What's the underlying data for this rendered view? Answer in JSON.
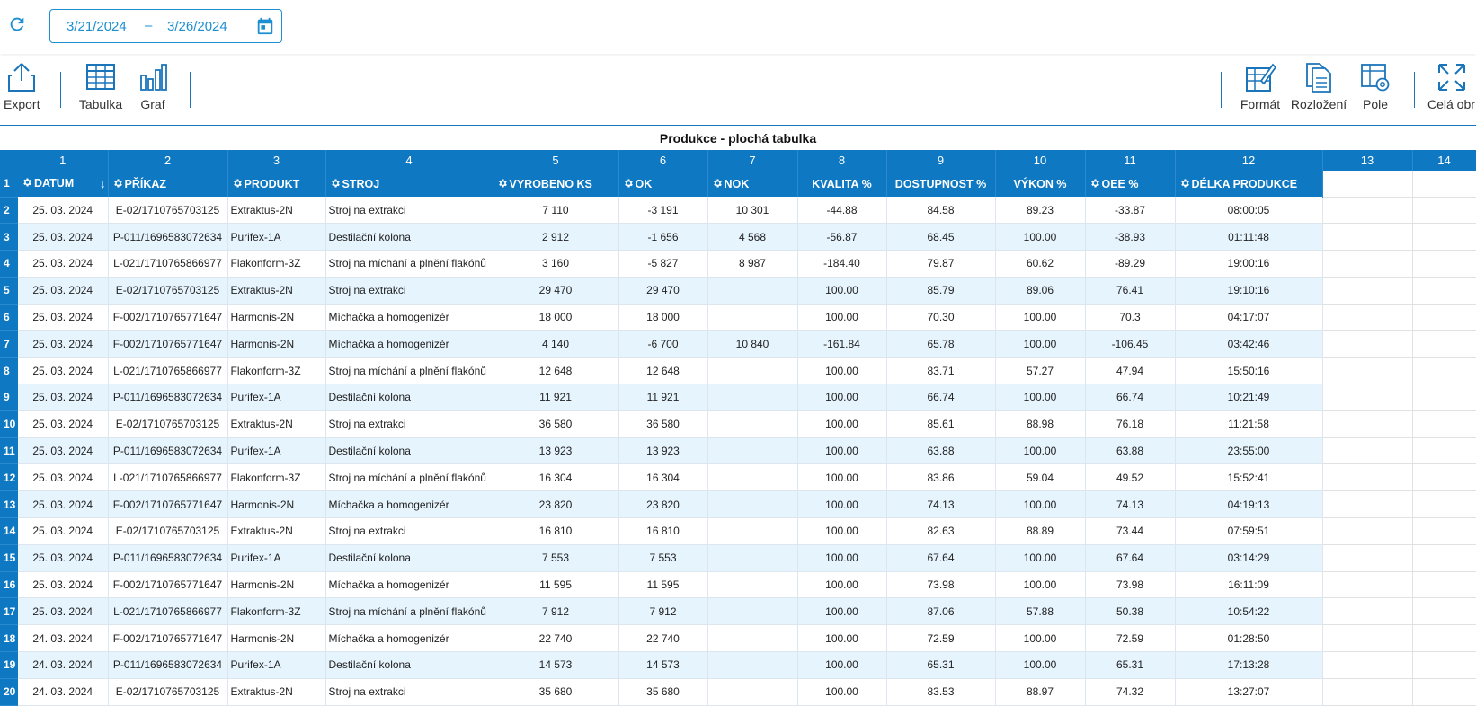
{
  "date_range": {
    "start": "3/21/2024",
    "separator": "–",
    "end": "3/26/2024"
  },
  "toolbar": {
    "export": "Export",
    "tabulka": "Tabulka",
    "graf": "Graf",
    "format": "Formát",
    "rozlozeni": "Rozložení",
    "pole": "Pole",
    "cela": "Celá obr"
  },
  "grid": {
    "title": "Produkce - plochá tabulka",
    "col_numbers": [
      "1",
      "2",
      "3",
      "4",
      "5",
      "6",
      "7",
      "8",
      "9",
      "10",
      "11",
      "12",
      "13",
      "14"
    ],
    "header_row_number": "1",
    "headers": [
      "DATUM",
      "PŘÍKAZ",
      "PRODUKT",
      "STROJ",
      "VYROBENO KS",
      "OK",
      "NOK",
      "KVALITA %",
      "DOSTUPNOST %",
      "VÝKON %",
      "OEE %",
      "DÉLKA PRODUKCE"
    ],
    "rows": [
      {
        "n": "2",
        "c": [
          "25. 03. 2024",
          "E-02/1710765703125",
          "Extraktus-2N",
          "Stroj na extrakci",
          "7 110",
          "-3 191",
          "10 301",
          "-44.88",
          "84.58",
          "89.23",
          "-33.87",
          "08:00:05"
        ]
      },
      {
        "n": "3",
        "c": [
          "25. 03. 2024",
          "P-011/1696583072634",
          "Purifex-1A",
          "Destilační kolona",
          "2 912",
          "-1 656",
          "4 568",
          "-56.87",
          "68.45",
          "100.00",
          "-38.93",
          "01:11:48"
        ]
      },
      {
        "n": "4",
        "c": [
          "25. 03. 2024",
          "L-021/1710765866977",
          "Flakonform-3Z",
          "Stroj na míchání a plnění flakónů",
          "3 160",
          "-5 827",
          "8 987",
          "-184.40",
          "79.87",
          "60.62",
          "-89.29",
          "19:00:16"
        ]
      },
      {
        "n": "5",
        "c": [
          "25. 03. 2024",
          "E-02/1710765703125",
          "Extraktus-2N",
          "Stroj na extrakci",
          "29 470",
          "29 470",
          "",
          "100.00",
          "85.79",
          "89.06",
          "76.41",
          "19:10:16"
        ]
      },
      {
        "n": "6",
        "c": [
          "25. 03. 2024",
          "F-002/1710765771647",
          "Harmonis-2N",
          "Míchačka a homogenizér",
          "18 000",
          "18 000",
          "",
          "100.00",
          "70.30",
          "100.00",
          "70.3",
          "04:17:07"
        ]
      },
      {
        "n": "7",
        "c": [
          "25. 03. 2024",
          "F-002/1710765771647",
          "Harmonis-2N",
          "Míchačka a homogenizér",
          "4 140",
          "-6 700",
          "10 840",
          "-161.84",
          "65.78",
          "100.00",
          "-106.45",
          "03:42:46"
        ]
      },
      {
        "n": "8",
        "c": [
          "25. 03. 2024",
          "L-021/1710765866977",
          "Flakonform-3Z",
          "Stroj na míchání a plnění flakónů",
          "12 648",
          "12 648",
          "",
          "100.00",
          "83.71",
          "57.27",
          "47.94",
          "15:50:16"
        ]
      },
      {
        "n": "9",
        "c": [
          "25. 03. 2024",
          "P-011/1696583072634",
          "Purifex-1A",
          "Destilační kolona",
          "11 921",
          "11 921",
          "",
          "100.00",
          "66.74",
          "100.00",
          "66.74",
          "10:21:49"
        ]
      },
      {
        "n": "10",
        "c": [
          "25. 03. 2024",
          "E-02/1710765703125",
          "Extraktus-2N",
          "Stroj na extrakci",
          "36 580",
          "36 580",
          "",
          "100.00",
          "85.61",
          "88.98",
          "76.18",
          "11:21:58"
        ]
      },
      {
        "n": "11",
        "c": [
          "25. 03. 2024",
          "P-011/1696583072634",
          "Purifex-1A",
          "Destilační kolona",
          "13 923",
          "13 923",
          "",
          "100.00",
          "63.88",
          "100.00",
          "63.88",
          "23:55:00"
        ]
      },
      {
        "n": "12",
        "c": [
          "25. 03. 2024",
          "L-021/1710765866977",
          "Flakonform-3Z",
          "Stroj na míchání a plnění flakónů",
          "16 304",
          "16 304",
          "",
          "100.00",
          "83.86",
          "59.04",
          "49.52",
          "15:52:41"
        ]
      },
      {
        "n": "13",
        "c": [
          "25. 03. 2024",
          "F-002/1710765771647",
          "Harmonis-2N",
          "Míchačka a homogenizér",
          "23 820",
          "23 820",
          "",
          "100.00",
          "74.13",
          "100.00",
          "74.13",
          "04:19:13"
        ]
      },
      {
        "n": "14",
        "c": [
          "25. 03. 2024",
          "E-02/1710765703125",
          "Extraktus-2N",
          "Stroj na extrakci",
          "16 810",
          "16 810",
          "",
          "100.00",
          "82.63",
          "88.89",
          "73.44",
          "07:59:51"
        ]
      },
      {
        "n": "15",
        "c": [
          "25. 03. 2024",
          "P-011/1696583072634",
          "Purifex-1A",
          "Destilační kolona",
          "7 553",
          "7 553",
          "",
          "100.00",
          "67.64",
          "100.00",
          "67.64",
          "03:14:29"
        ]
      },
      {
        "n": "16",
        "c": [
          "25. 03. 2024",
          "F-002/1710765771647",
          "Harmonis-2N",
          "Míchačka a homogenizér",
          "11 595",
          "11 595",
          "",
          "100.00",
          "73.98",
          "100.00",
          "73.98",
          "16:11:09"
        ]
      },
      {
        "n": "17",
        "c": [
          "25. 03. 2024",
          "L-021/1710765866977",
          "Flakonform-3Z",
          "Stroj na míchání a plnění flakónů",
          "7 912",
          "7 912",
          "",
          "100.00",
          "87.06",
          "57.88",
          "50.38",
          "10:54:22"
        ]
      },
      {
        "n": "18",
        "c": [
          "24. 03. 2024",
          "F-002/1710765771647",
          "Harmonis-2N",
          "Míchačka a homogenizér",
          "22 740",
          "22 740",
          "",
          "100.00",
          "72.59",
          "100.00",
          "72.59",
          "01:28:50"
        ]
      },
      {
        "n": "19",
        "c": [
          "24. 03. 2024",
          "P-011/1696583072634",
          "Purifex-1A",
          "Destilační kolona",
          "14 573",
          "14 573",
          "",
          "100.00",
          "65.31",
          "100.00",
          "65.31",
          "17:13:28"
        ]
      },
      {
        "n": "20",
        "c": [
          "24. 03. 2024",
          "E-02/1710765703125",
          "Extraktus-2N",
          "Stroj na extrakci",
          "35 680",
          "35 680",
          "",
          "100.00",
          "83.53",
          "88.97",
          "74.32",
          "13:27:07"
        ]
      }
    ]
  },
  "colors": {
    "accent": "#1d8fd1",
    "header_blue": "#0e78c2",
    "row_stripe": "#e6f4fd"
  }
}
